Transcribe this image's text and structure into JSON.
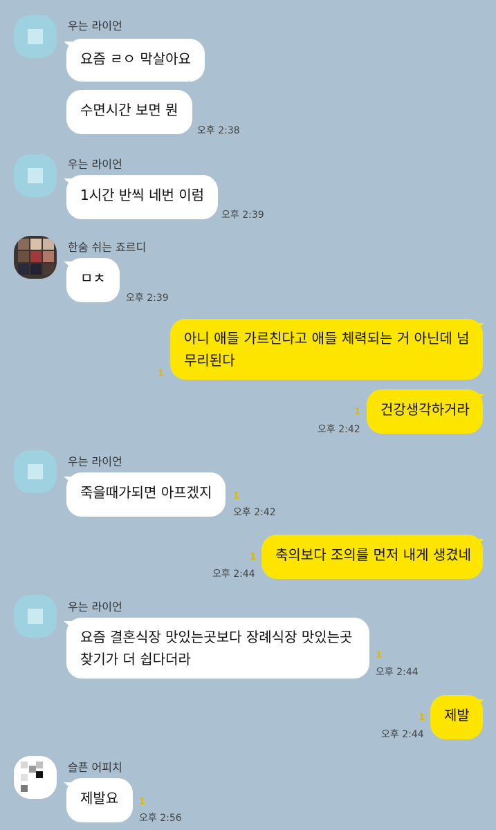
{
  "chat": {
    "colors": {
      "background": "#abc1d1",
      "outgoing_bubble": "#fee500",
      "incoming_bubble": "#ffffff",
      "unread_count": "#e0b800"
    },
    "senders": {
      "lion": "우는 라이언",
      "jordy": "한숨 쉬는 죠르디",
      "apeach": "슬픈 어피치"
    },
    "messages": [
      {
        "id": 1,
        "from": "lion",
        "text": "요즘 ㄹㅇ 막살아요"
      },
      {
        "id": 2,
        "from": "lion",
        "text": "수면시간 보면 뭔",
        "time": "오후 2:38"
      },
      {
        "id": 3,
        "from": "lion",
        "text": "1시간 반씩 네번 이럼",
        "time": "오후 2:39"
      },
      {
        "id": 4,
        "from": "jordy",
        "text": "ㅁㅊ",
        "time": "오후 2:39"
      },
      {
        "id": 5,
        "from": "me",
        "line1": "아니 애들 가르친다고 애들 체력되는 거 아닌데 넘",
        "line2": "무리된다",
        "unread": "1"
      },
      {
        "id": 6,
        "from": "me",
        "text": "건강생각하거라",
        "unread": "1",
        "time": "오후 2:42"
      },
      {
        "id": 7,
        "from": "lion",
        "text": "죽을때가되면 아프겠지",
        "unread": "1",
        "time": "오후 2:42"
      },
      {
        "id": 8,
        "from": "me",
        "text": "축의보다 조의를 먼저 내게 생겼네",
        "unread": "1",
        "time": "오후 2:44"
      },
      {
        "id": 9,
        "from": "lion",
        "line1": "요즘 결혼식장 맛있는곳보다 장례식장 맛있는곳",
        "line2": "찾기가 더 쉽다더라",
        "unread": "1",
        "time": "오후 2:44"
      },
      {
        "id": 10,
        "from": "me",
        "text": "제발",
        "unread": "1",
        "time": "오후 2:44"
      },
      {
        "id": 11,
        "from": "apeach",
        "text": "제발요",
        "unread": "1",
        "time": "오후 2:56"
      }
    ]
  }
}
